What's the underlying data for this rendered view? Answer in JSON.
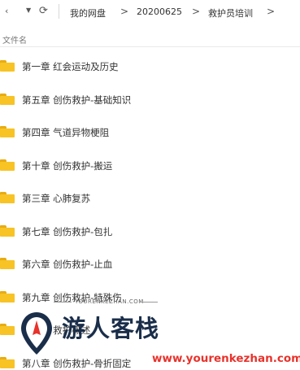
{
  "toolbar": {
    "back_icon": "chevron-left-icon",
    "dropdown_icon": "caret-down-icon",
    "refresh_icon": "refresh-icon",
    "separator": ">",
    "breadcrumb": [
      "我的网盘",
      "20200625",
      "救护员培训"
    ]
  },
  "list_header": {
    "name_column": "文件名"
  },
  "folders": [
    {
      "name": "第一章 红会运动及历史"
    },
    {
      "name": "第五章 创伤救护-基础知识"
    },
    {
      "name": "第四章 气道异物梗阻"
    },
    {
      "name": "第十章 创伤救护-搬运"
    },
    {
      "name": "第三章 心肺复苏"
    },
    {
      "name": "第七章 创伤救护-包扎"
    },
    {
      "name": "第六章 创伤救护-止血"
    },
    {
      "name": "第九章 创伤救护-特殊伤"
    },
    {
      "name": "第二章 救护概述"
    },
    {
      "name": "第八章 创伤救护-骨折固定"
    }
  ],
  "watermark": {
    "subtitle": "YOURENKEZHAN.COM",
    "title": "游人客栈",
    "url": "www.yourenkezhan.com",
    "accent_color": "#e8322b",
    "brand_color": "#1a2e4a",
    "folder_color": "#f7c325"
  }
}
